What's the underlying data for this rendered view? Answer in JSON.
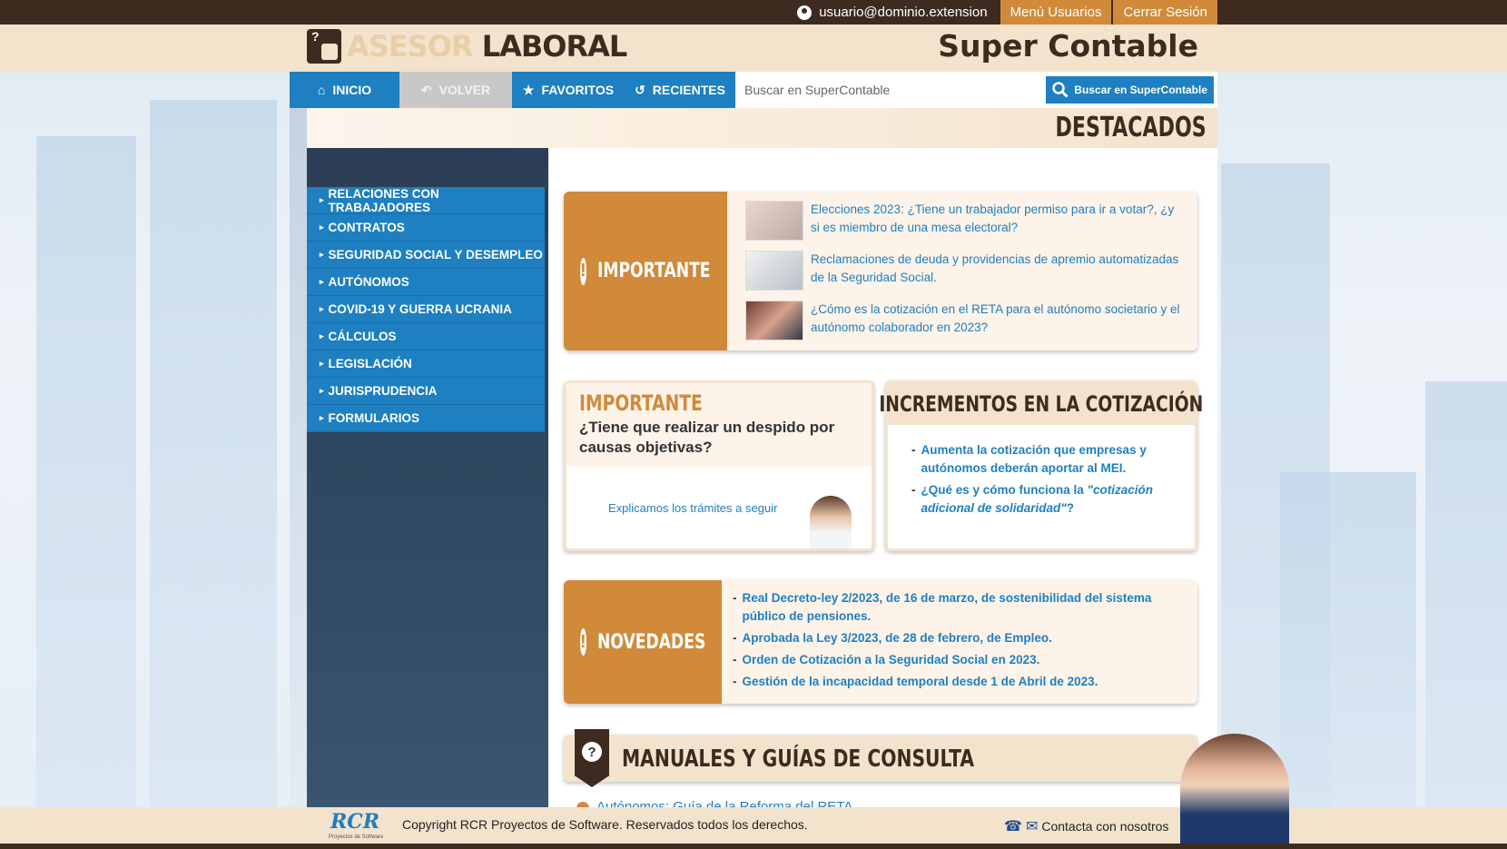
{
  "topbar": {
    "user": "usuario@dominio.extension",
    "menu_usuarios": "Menú Usuarios",
    "cerrar_sesion": "Cerrar Sesión"
  },
  "header": {
    "logo_part1": "ASESOR",
    "logo_part2": "LABORAL",
    "brand": "Super Contable"
  },
  "nav": {
    "inicio": "INICIO",
    "volver": "VOLVER",
    "favoritos": "FAVORITOS",
    "recientes": "RECIENTES",
    "search_placeholder": "Buscar en SuperContable",
    "search_button": "Buscar en SuperContable"
  },
  "page_title": "DESTACADOS",
  "sidebar": {
    "items": [
      {
        "label": "RELACIONES CON TRABAJADORES"
      },
      {
        "label": "CONTRATOS"
      },
      {
        "label": "SEGURIDAD SOCIAL Y DESEMPLEO"
      },
      {
        "label": "AUTÓNOMOS"
      },
      {
        "label": "COVID-19 Y GUERRA UCRANIA"
      },
      {
        "label": "CÁLCULOS"
      },
      {
        "label": "LEGISLACIÓN"
      },
      {
        "label": "JURISPRUDENCIA"
      },
      {
        "label": "FORMULARIOS"
      }
    ]
  },
  "importante": {
    "title": "IMPORTANTE",
    "items": [
      {
        "text": "Elecciones 2023: ¿Tiene un trabajador permiso para ir a votar?, ¿y si es miembro de una mesa electoral?"
      },
      {
        "text": "Reclamaciones de deuda y providencias de apremio automatizadas de la Seguridad Social."
      },
      {
        "text": "¿Cómo es la cotización en el RETA para el autónomo societario y el autónomo colaborador en 2023?"
      }
    ]
  },
  "despido": {
    "label": "IMPORTANTE",
    "question": "¿Tiene que realizar un despido por causas objetivas?",
    "link": "Explicamos los trámites a seguir"
  },
  "incrementos": {
    "title": "INCREMENTOS EN LA COTIZACIÓN",
    "items": [
      {
        "text": "Aumenta la cotización que empresas y autónomos deberán aportar al MEI."
      },
      {
        "prefix": "¿Qué es y cómo funciona la ",
        "emph": "\"cotización adicional de solidaridad\"",
        "suffix": "?"
      }
    ]
  },
  "novedades": {
    "title": "NOVEDADES",
    "items": [
      {
        "text": "Real Decreto-ley 2/2023, de 16 de marzo, de sostenibilidad del sistema público de pensiones."
      },
      {
        "text": "Aprobada la Ley 3/2023, de 28 de febrero, de Empleo."
      },
      {
        "text": "Orden de Cotización a la Seguridad Social en 2023."
      },
      {
        "text": "Gestión de la incapacidad temporal desde 1 de Abril de 2023."
      }
    ]
  },
  "manuales": {
    "title": "MANUALES Y GUÍAS DE CONSULTA",
    "first_item": "Autónomos: Guía de la Reforma del RETA"
  },
  "footer": {
    "logo": "RCR",
    "logo_sub": "Proyectos de Software",
    "copyright": "Copyright RCR Proyectos de Software. Reservados todos los derechos.",
    "contact": "Contacta con nosotros"
  },
  "colors": {
    "accent_blue": "#1e7fc1",
    "accent_orange": "#d08a3a",
    "dark_brown": "#3d2b1f",
    "cream": "#f3e3cc"
  }
}
